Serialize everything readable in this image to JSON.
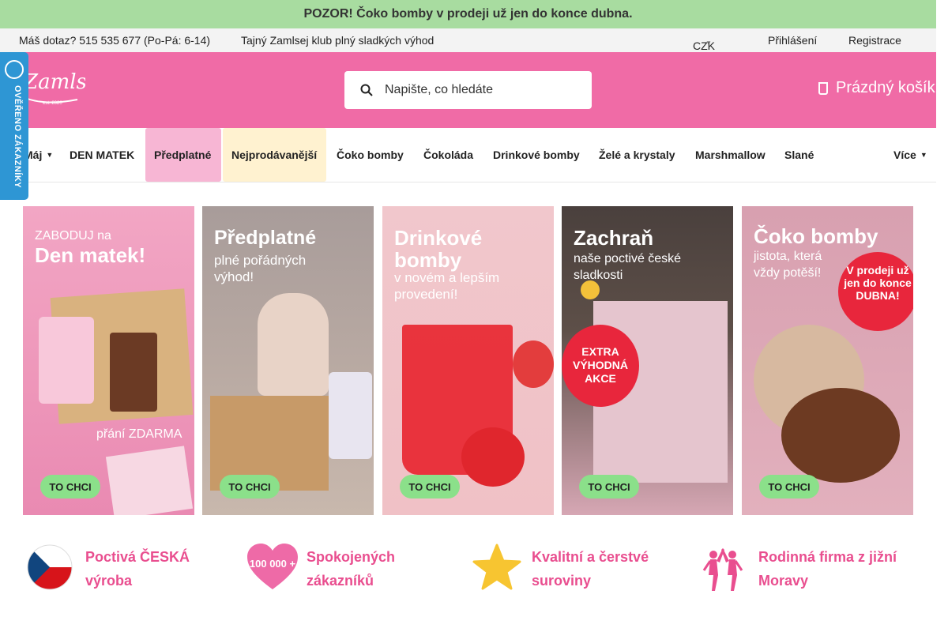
{
  "promo": "POZOR! Čoko bomby v prodeji už jen do konce dubna.",
  "topbar": {
    "contact": "Máš dotaz? 515 535 677 (Po-Pá: 6-14)",
    "club": "Tajný Zamlsej klub  plný sladkých výhod",
    "currency": "CZK",
    "login": "Přihlášení",
    "register": "Registrace"
  },
  "header": {
    "logo_text": "Zamlsej",
    "logo_year": "est. 2020",
    "search_placeholder": "Napište, co hledáte",
    "cart": "Prázdný košík"
  },
  "verified_badge": "OVĚŘENO ZÁKAZNÍKY",
  "nav": [
    "Máj",
    "DEN MATEK",
    "Předplatné",
    "Nejprodávanější",
    "Čoko bomby",
    "Čokoláda",
    "Drinkové bomby",
    "Želé a krystaly",
    "Marshmallow",
    "Slané",
    "Více"
  ],
  "banners": [
    {
      "line1": "ZABODUJ na",
      "line2": "Den matek!",
      "extra": "přání ZDARMA",
      "cta": "TO CHCI"
    },
    {
      "line1": "Předplatné",
      "line2": "plné pořádných výhod!",
      "cta": "TO CHCI"
    },
    {
      "line1": "Drinkové bomby",
      "line2": "v novém a lepším provedení!",
      "cta": "TO CHCI"
    },
    {
      "line1": "Zachraň",
      "line2": "naše poctivé české sladkosti",
      "badge": "EXTRA VÝHODNÁ AKCE",
      "cta": "TO CHCI"
    },
    {
      "line1": "Čoko bomby",
      "line2": "jistota, která vždy potěší!",
      "badge": "V prodeji už jen do konce DUBNA!",
      "cta": "TO CHCI"
    }
  ],
  "features": [
    {
      "icon": "czech-flag-icon",
      "text": "Poctivá ČESKÁ výroba"
    },
    {
      "icon": "heart-icon",
      "badge": "100 000 +",
      "text": "Spokojených zákazníků"
    },
    {
      "icon": "star-icon",
      "text": "Kvalitní a čerstvé suroviny"
    },
    {
      "icon": "family-icon",
      "text": "Rodinná firma z jižní Moravy"
    }
  ],
  "colors": {
    "brand_pink": "#f06ba6",
    "promo_green": "#a8dca0",
    "feature_pink": "#e94e8f",
    "verified_blue": "#2e96d4"
  }
}
